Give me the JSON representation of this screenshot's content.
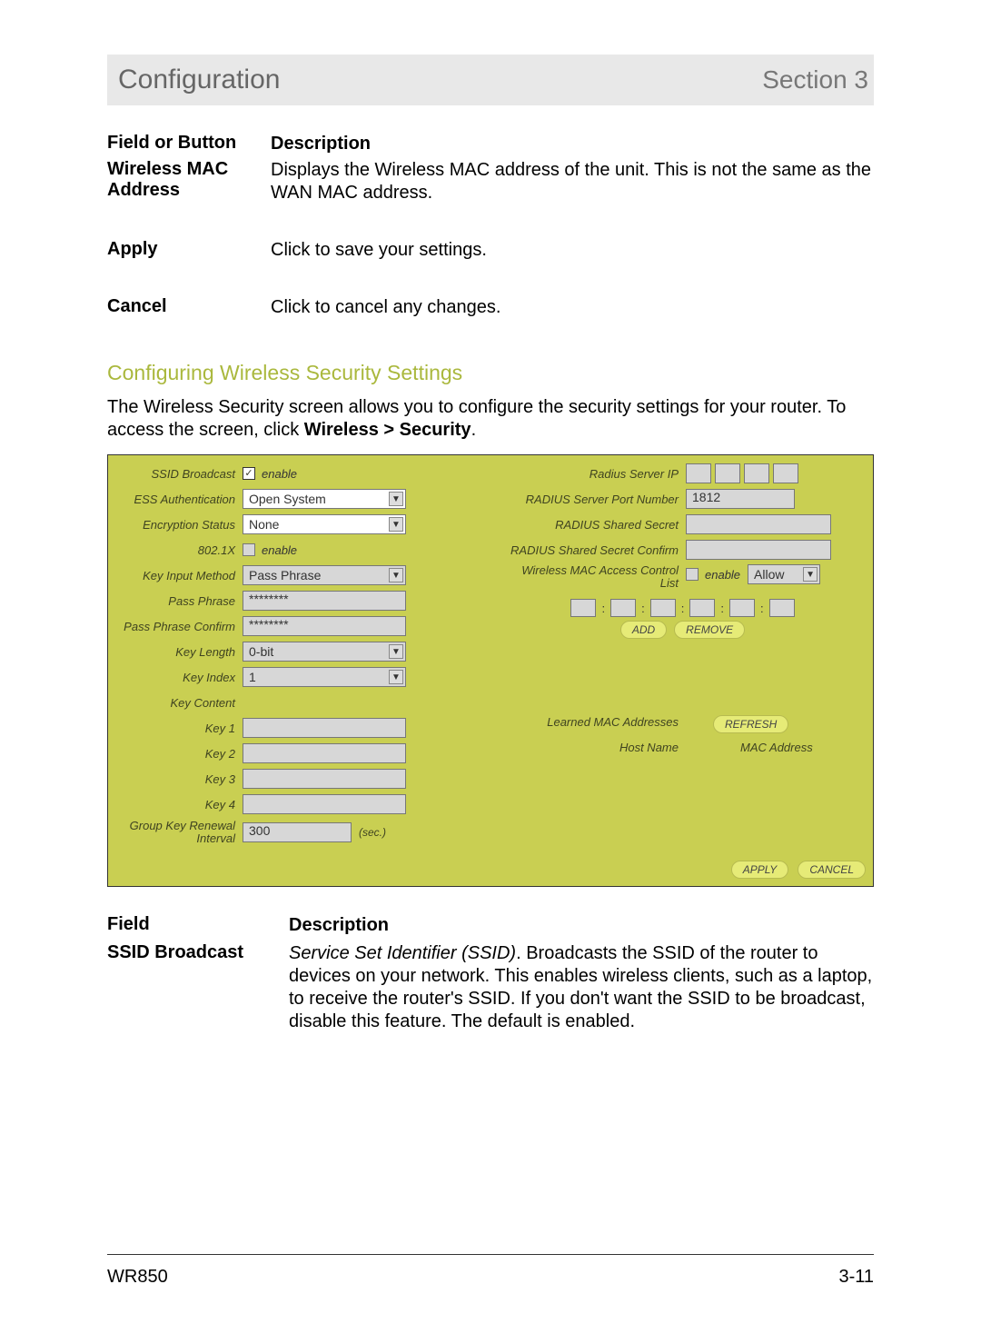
{
  "header": {
    "title": "Configuration",
    "section": "Section 3"
  },
  "table1": {
    "h_field": "Field or Button",
    "h_desc": "Description",
    "r1_field": "Wireless MAC Address",
    "r1_desc": "Displays the Wireless MAC address of the unit. This is not the same as the WAN MAC address.",
    "r2_field": "Apply",
    "r2_desc": "Click to save your settings.",
    "r3_field": "Cancel",
    "r3_desc": "Click to cancel any changes."
  },
  "section_heading": "Configuring Wireless Security Settings",
  "intro_text": "The Wireless Security screen allows you to configure the security settings for your router. To access the screen, click ",
  "intro_bold": "Wireless > Security",
  "intro_tail": ".",
  "panel": {
    "left": {
      "ssid_broadcast_label": "SSID Broadcast",
      "enable": "enable",
      "ess_auth_label": "ESS Authentication",
      "ess_auth_value": "Open System",
      "enc_status_label": "Encryption Status",
      "enc_status_value": "None",
      "x8021_label": "802.1X",
      "key_input_label": "Key Input Method",
      "key_input_value": "Pass Phrase",
      "pass_phrase_label": "Pass Phrase",
      "pass_phrase_value": "********",
      "pass_phrase_confirm_label": "Pass Phrase Confirm",
      "pass_phrase_confirm_value": "********",
      "key_length_label": "Key Length",
      "key_length_value": "0-bit",
      "key_index_label": "Key Index",
      "key_index_value": "1",
      "key_content_label": "Key Content",
      "key1_label": "Key 1",
      "key2_label": "Key 2",
      "key3_label": "Key 3",
      "key4_label": "Key 4",
      "group_key_label_l1": "Group Key Renewal",
      "group_key_label_l2": "Interval",
      "group_key_value": "300",
      "sec_suffix": "(sec.)"
    },
    "right": {
      "radius_server_ip_label": "Radius Server IP",
      "radius_port_label": "RADIUS Server Port Number",
      "radius_port_value": "1812",
      "radius_secret_label": "RADIUS Shared Secret",
      "radius_secret_confirm_label": "RADIUS Shared Secret Confirm",
      "mac_acl_label_l1": "Wireless MAC Access Control",
      "mac_acl_label_l2": "List",
      "mac_acl_enable": "enable",
      "mac_acl_mode": "Allow",
      "btn_add": "ADD",
      "btn_remove": "REMOVE",
      "learned_label": "Learned MAC Addresses",
      "btn_refresh": "REFRESH",
      "hostname_label": "Host Name",
      "macaddr_label": "MAC Address",
      "btn_apply": "APPLY",
      "btn_cancel": "CANCEL"
    }
  },
  "table2": {
    "h_field": "Field",
    "h_desc": "Description",
    "r1_field": "SSID Broadcast",
    "r1_desc_em": "Service Set Identifier (SSID)",
    "r1_desc_rest": ". Broadcasts the SSID of the router to devices on your network. This enables wireless clients, such as a laptop, to receive the router's SSID. If you don't want the SSID to be broadcast, disable this feature. The default is enabled."
  },
  "footer": {
    "left": "WR850",
    "right": "3-11"
  }
}
